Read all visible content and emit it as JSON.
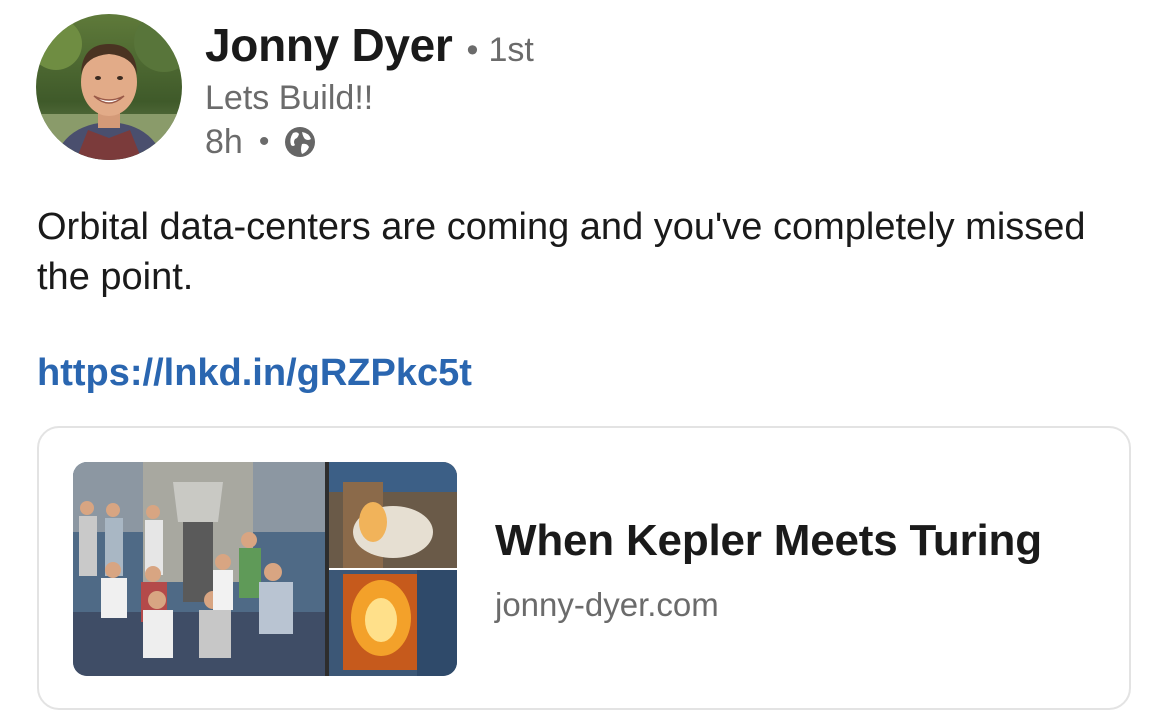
{
  "author": {
    "name": "Jonny Dyer",
    "degree": "1st",
    "headline": "Lets Build!!",
    "time": "8h",
    "visibility_icon": "globe-icon"
  },
  "separators": {
    "dot": "•"
  },
  "post": {
    "text": "Orbital data-centers are coming and you've completely missed the point.",
    "link": "https://lnkd.in/gRZPkc5t"
  },
  "link_preview": {
    "title": "When Kepler Meets Turing",
    "domain": "jonny-dyer.com"
  },
  "colors": {
    "link": "#2a66b0",
    "secondary_text": "#6b6b6b",
    "primary_text": "#1a1a1a",
    "card_border": "#e3e3e3"
  }
}
